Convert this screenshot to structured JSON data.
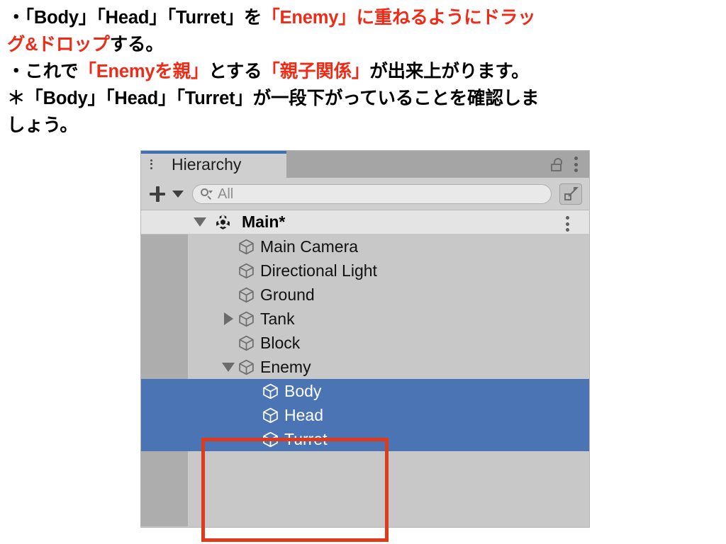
{
  "instructions": {
    "lines": [
      [
        {
          "t": "・「Body」「Head」「Turret」を",
          "c": "black"
        },
        {
          "t": "「Enemy」に重ねるようにドラッ",
          "c": "red"
        }
      ],
      [
        {
          "t": "グ&ドロップ",
          "c": "red"
        },
        {
          "t": "する。",
          "c": "black"
        }
      ],
      [
        {
          "t": "・これで",
          "c": "black"
        },
        {
          "t": "「Enemyを親」",
          "c": "red"
        },
        {
          "t": "とする",
          "c": "black"
        },
        {
          "t": "「親子関係」",
          "c": "red"
        },
        {
          "t": "が出来上がります。",
          "c": "black"
        }
      ],
      [
        {
          "t": "＊「Body」「Head」「Turret」が一段下がっていることを確認しま",
          "c": "black"
        }
      ],
      [
        {
          "t": "しょう。",
          "c": "black"
        }
      ]
    ],
    "highlight_color": "#ef2b17",
    "text_color": "#000000"
  },
  "panel": {
    "tab": {
      "label": "Hierarchy",
      "icon": "list-icon",
      "accent_color": "#3d6fba"
    },
    "tab_actions": {
      "lock": "lock-open-icon",
      "menu": "kebab-menu-icon"
    },
    "toolbar": {
      "add_label": "+",
      "add_dropdown": "chevron-down-icon",
      "search_placeholder": "All",
      "search_value": "",
      "search_icon": "search-icon",
      "expand_icon": "open-in-new-icon"
    },
    "scene": {
      "name": "Main*",
      "expanded": true,
      "icon": "unity-scene-icon",
      "menu": "kebab-menu-icon"
    },
    "tree": [
      {
        "name": "Main Camera",
        "indent": 1,
        "twisty": "none",
        "selected": false,
        "icon": "gameobject-cube-icon"
      },
      {
        "name": "Directional Light",
        "indent": 1,
        "twisty": "none",
        "selected": false,
        "icon": "gameobject-cube-icon"
      },
      {
        "name": "Ground",
        "indent": 1,
        "twisty": "none",
        "selected": false,
        "icon": "gameobject-cube-icon"
      },
      {
        "name": "Tank",
        "indent": 1,
        "twisty": "collapsed",
        "selected": false,
        "icon": "gameobject-cube-icon"
      },
      {
        "name": "Block",
        "indent": 1,
        "twisty": "none",
        "selected": false,
        "icon": "gameobject-cube-icon"
      },
      {
        "name": "Enemy",
        "indent": 1,
        "twisty": "expanded",
        "selected": false,
        "icon": "gameobject-cube-icon"
      },
      {
        "name": "Body",
        "indent": 2,
        "twisty": "none",
        "selected": true,
        "icon": "gameobject-cube-icon"
      },
      {
        "name": "Head",
        "indent": 2,
        "twisty": "none",
        "selected": true,
        "icon": "gameobject-cube-icon"
      },
      {
        "name": "Turret",
        "indent": 2,
        "twisty": "none",
        "selected": true,
        "icon": "gameobject-cube-icon"
      }
    ],
    "selection_color": "#4a74b4",
    "annotation_box_color": "#e03a1c"
  }
}
